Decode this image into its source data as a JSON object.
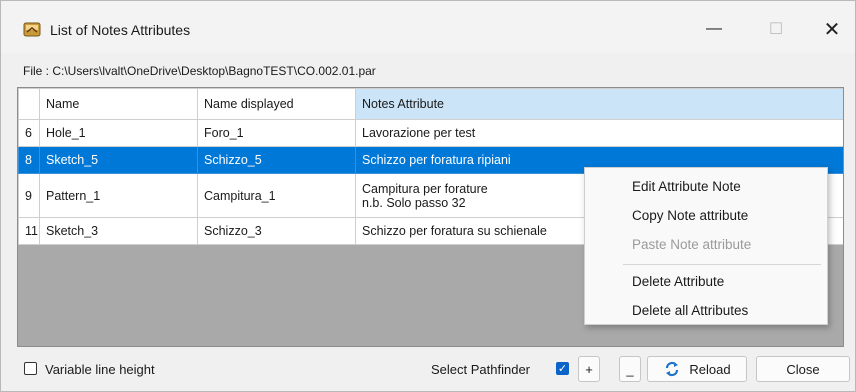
{
  "window": {
    "title": "List of Notes Attributes",
    "minimize_glyph": "—",
    "maximize_glyph": "☐",
    "close_glyph": "✕"
  },
  "file_line": "File :  C:\\Users\\lvalt\\OneDrive\\Desktop\\BagnoTEST\\CO.002.01.par",
  "table": {
    "columns": [
      "",
      "Name",
      "Name displayed",
      "Notes Attribute"
    ],
    "active_column": "Notes Attribute",
    "rows": [
      {
        "num": "6",
        "name": "Hole_1",
        "displayed": "Foro_1",
        "note": "Lavorazione per test"
      },
      {
        "num": "8",
        "name": "Sketch_5",
        "displayed": "Schizzo_5",
        "note": "Schizzo per foratura ripiani",
        "selected": true
      },
      {
        "num": "9",
        "name": "Pattern_1",
        "displayed": "Campitura_1",
        "note_line1": "Campitura per forature",
        "note_line2": "n.b. Solo passo 32"
      },
      {
        "num": "11",
        "name": "Sketch_3",
        "displayed": "Schizzo_3",
        "note": "Schizzo per foratura su schienale"
      }
    ]
  },
  "context_menu": {
    "items": [
      {
        "label": "Edit Attribute Note",
        "enabled": true
      },
      {
        "label": "Copy Note attribute",
        "enabled": true
      },
      {
        "label": "Paste Note attribute",
        "enabled": false
      },
      {
        "label": "Delete Attribute",
        "enabled": true
      },
      {
        "label": "Delete all Attributes",
        "enabled": true
      }
    ]
  },
  "footer": {
    "variable_line_height_label": "Variable line height",
    "variable_line_height_checked": false,
    "select_pathfinder_label": "Select Pathfinder",
    "select_pathfinder_checked": true,
    "plus_label": "+",
    "minus_label": "_",
    "reload_label": "Reload",
    "close_label": "Close"
  },
  "colors": {
    "selection": "#0078d7",
    "active_header": "#cce4f7",
    "grid_background": "#a9a9a9"
  },
  "icons": {
    "app": "notes-app-icon",
    "reload": "reload-icon",
    "check": "checkmark-icon"
  }
}
